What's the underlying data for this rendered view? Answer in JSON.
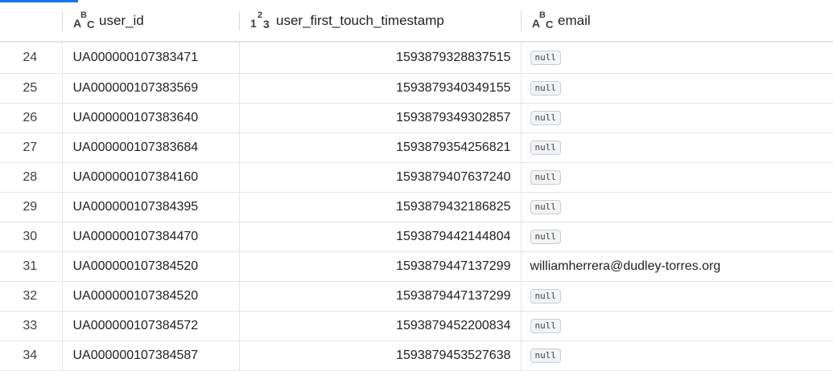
{
  "table": {
    "columns": [
      {
        "name": "user_id",
        "type_icon": "abc-type-icon"
      },
      {
        "name": "user_first_touch_timestamp",
        "type_icon": "123-type-icon"
      },
      {
        "name": "email",
        "type_icon": "abc-type-icon"
      }
    ],
    "type_glyphs": {
      "abc": [
        "A",
        "B",
        "C"
      ],
      "num": [
        "1",
        "2",
        "3"
      ]
    },
    "null_label": "null",
    "rows": [
      {
        "n": "24",
        "user_id": "UA000000107383471",
        "ts": "1593879328837515",
        "email": null
      },
      {
        "n": "25",
        "user_id": "UA000000107383569",
        "ts": "1593879340349155",
        "email": null
      },
      {
        "n": "26",
        "user_id": "UA000000107383640",
        "ts": "1593879349302857",
        "email": null
      },
      {
        "n": "27",
        "user_id": "UA000000107383684",
        "ts": "1593879354256821",
        "email": null
      },
      {
        "n": "28",
        "user_id": "UA000000107384160",
        "ts": "1593879407637240",
        "email": null
      },
      {
        "n": "29",
        "user_id": "UA000000107384395",
        "ts": "1593879432186825",
        "email": null
      },
      {
        "n": "30",
        "user_id": "UA000000107384470",
        "ts": "1593879442144804",
        "email": null
      },
      {
        "n": "31",
        "user_id": "UA000000107384520",
        "ts": "1593879447137299",
        "email": "williamherrera@dudley-torres.org"
      },
      {
        "n": "32",
        "user_id": "UA000000107384520",
        "ts": "1593879447137299",
        "email": null
      },
      {
        "n": "33",
        "user_id": "UA000000107384572",
        "ts": "1593879452200834",
        "email": null
      },
      {
        "n": "34",
        "user_id": "UA000000107384587",
        "ts": "1593879453527638",
        "email": null
      }
    ]
  },
  "colors": {
    "accent": "#1a73e8",
    "grid": "#e3e6ea"
  }
}
